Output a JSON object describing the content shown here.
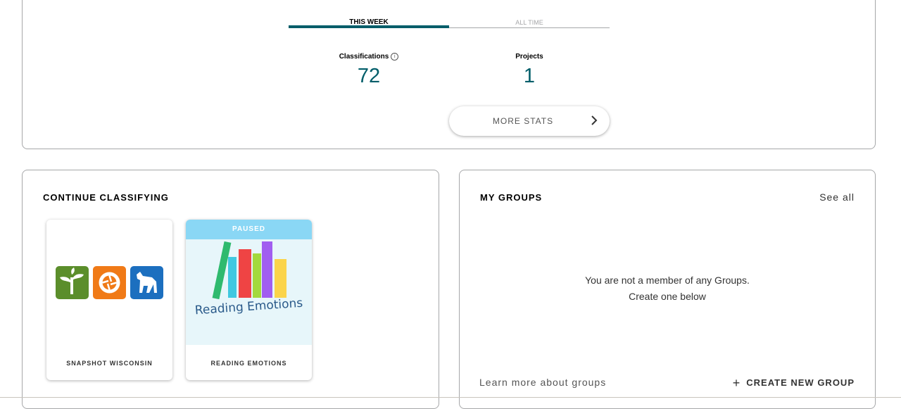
{
  "stats": {
    "tabs": [
      {
        "label": "THIS WEEK",
        "active": true
      },
      {
        "label": "ALL TIME",
        "active": false
      }
    ],
    "classifications_label": "Classifications",
    "info_icon": "info-icon",
    "classifications_value": "72",
    "projects_label": "Projects",
    "projects_value": "1",
    "more_stats_label": "MORE STATS",
    "accent_color": "#005d69"
  },
  "continue_classifying": {
    "title": "CONTINUE CLASSIFYING",
    "projects": [
      {
        "name": "SNAPSHOT WISCONSIN",
        "icons": [
          "sprout-icon",
          "camera-shutter-icon",
          "deer-icon"
        ]
      },
      {
        "name": "READING EMOTIONS",
        "status": "PAUSED",
        "artwork_text": "Reading Emotions"
      }
    ]
  },
  "my_groups": {
    "title": "MY GROUPS",
    "see_all": "See all",
    "empty_line1": "You are not a member of any Groups.",
    "empty_line2": "Create one below",
    "learn_more": "Learn more about groups",
    "create_label": "CREATE NEW GROUP"
  }
}
